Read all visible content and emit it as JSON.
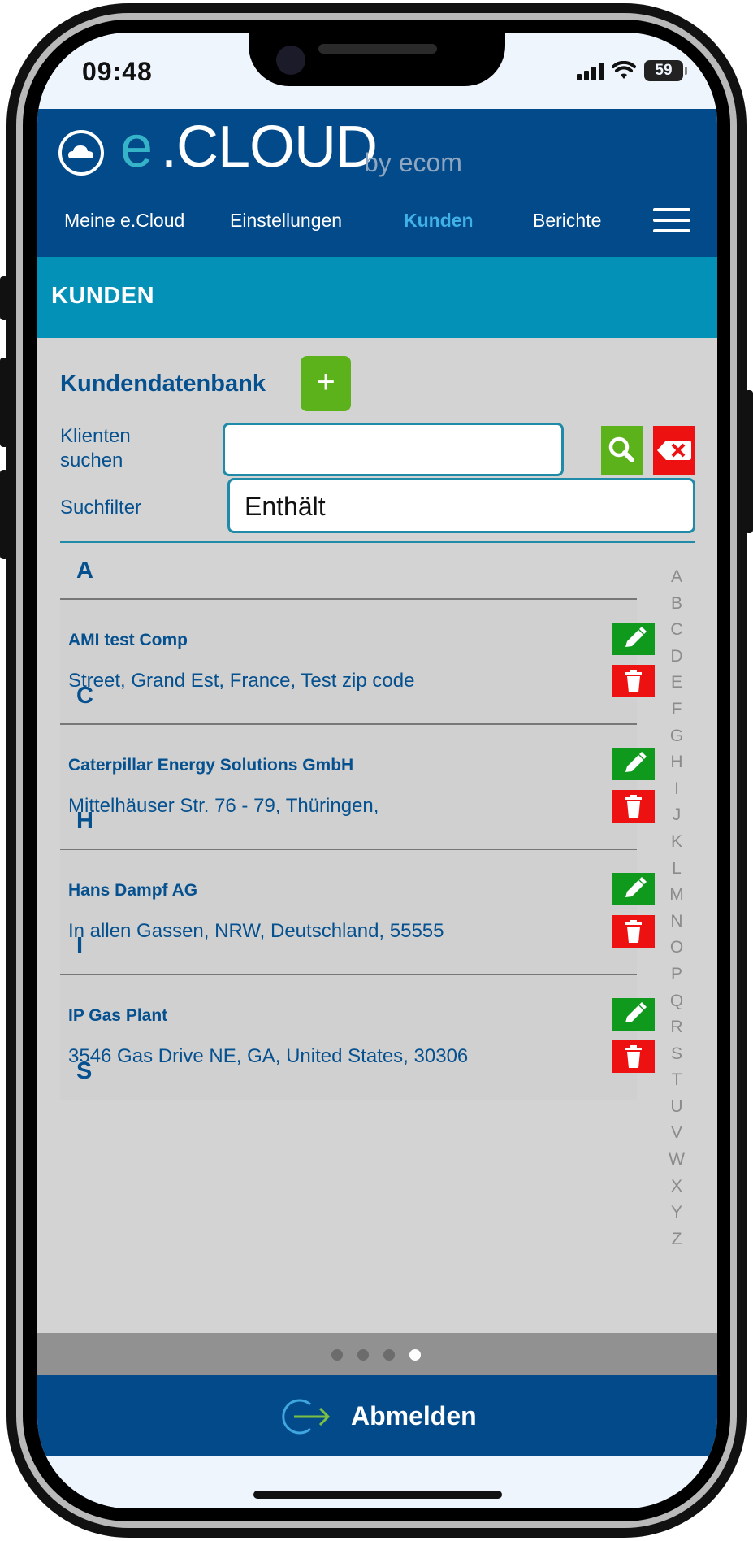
{
  "status_bar": {
    "time": "09:48",
    "battery": "59"
  },
  "header": {
    "logo_e": "e",
    "logo_text": ".CLOUD",
    "logo_by": "by ecom",
    "nav": [
      {
        "label": "Meine e.Cloud"
      },
      {
        "label": "Einstellungen"
      },
      {
        "label": "Kunden"
      },
      {
        "label": "Berichte"
      }
    ],
    "active_nav": "Kunden"
  },
  "section": {
    "title": "KUNDEN"
  },
  "database": {
    "title": "Kundendatenbank",
    "add_label": "+",
    "search_label_line1": "Klienten",
    "search_label_line2": "suchen",
    "search_value": "",
    "filter_label": "Suchfilter",
    "filter_value": "Enthält"
  },
  "groups": [
    {
      "letter": "A",
      "entries": [
        {
          "name": "AMI test Comp",
          "address": "Street, Grand Est, France, Test zip code"
        }
      ]
    },
    {
      "letter": "C",
      "entries": [
        {
          "name": "Caterpillar Energy Solutions GmbH",
          "address": "Mittelhäuser Str. 76 - 79, Thüringen,"
        }
      ]
    },
    {
      "letter": "H",
      "entries": [
        {
          "name": "Hans Dampf AG",
          "address": "In allen Gassen, NRW, Deutschland, 55555"
        }
      ]
    },
    {
      "letter": "I",
      "entries": [
        {
          "name": "IP Gas Plant",
          "address": "3546 Gas Drive NE, GA, United States, 30306"
        }
      ]
    },
    {
      "letter": "S",
      "entries": []
    }
  ],
  "alphabet": [
    "A",
    "B",
    "C",
    "D",
    "E",
    "F",
    "G",
    "H",
    "I",
    "J",
    "K",
    "L",
    "M",
    "N",
    "O",
    "P",
    "Q",
    "R",
    "S",
    "T",
    "U",
    "V",
    "W",
    "X",
    "Y",
    "Z"
  ],
  "pager": {
    "total": 4,
    "active": 4
  },
  "footer": {
    "logout_label": "Abmelden"
  },
  "colors": {
    "header_bg": "#034a8a",
    "section_bg": "#0491b7",
    "content_bg": "#d3d3d3",
    "add_green": "#5cb21b",
    "edit_green": "#0f9a1e",
    "delete_red": "#ee1111"
  },
  "icons": {
    "search": "magnifier-icon",
    "clear": "backspace-x-icon",
    "edit": "pencil-icon",
    "delete": "trash-icon",
    "logout": "logout-arrow-icon",
    "menu": "hamburger-menu-icon"
  }
}
